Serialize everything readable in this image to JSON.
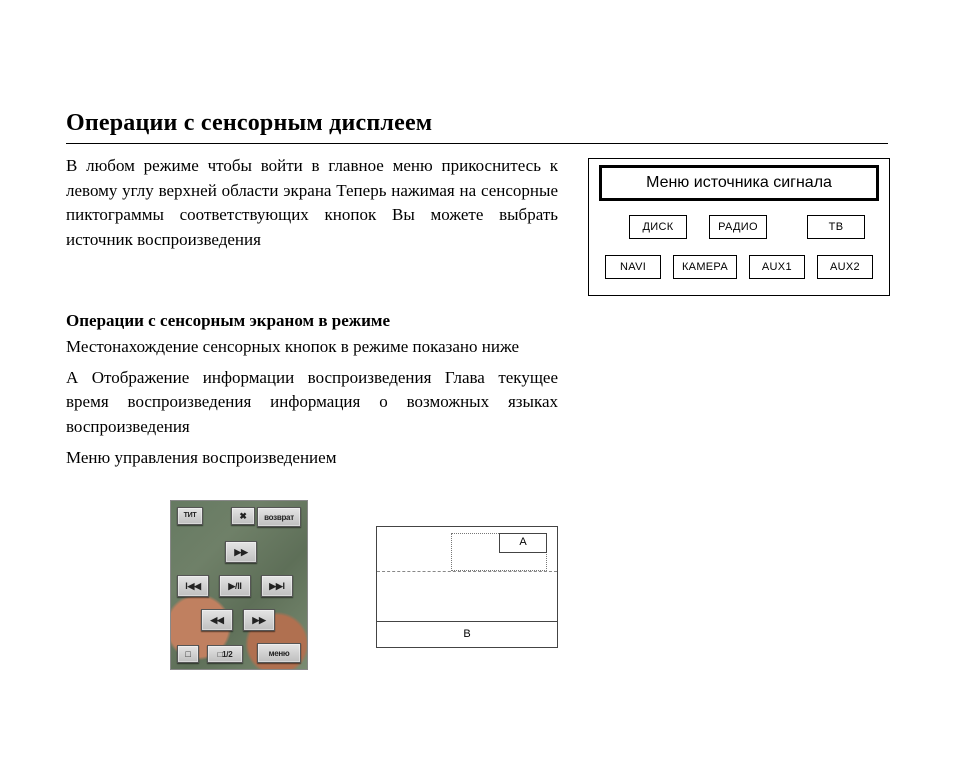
{
  "title": "Операции с сенсорным дисплеем",
  "intro": "В любом режиме чтобы войти в главное меню прикоснитесь к левому углу верхней области экрана Теперь нажимая на сенсорные пиктограммы соответствующих кнопок Вы можете выбрать источник воспроизведения",
  "section2": {
    "heading": "Операции с сенсорным экраном в режиме",
    "line1": "Местонахождение сенсорных кнопок в режиме показано ниже",
    "line2": "А Отображение информации воспроизведения Глава текущее время воспроизведения информация о возможных языках воспроизведения",
    "line3": "Меню управления воспроизведением"
  },
  "source_menu": {
    "title": "Меню источника сигнала",
    "row1": [
      "ДИСК",
      "РАДИО",
      "ТВ"
    ],
    "row2": [
      "NAVI",
      "КАМЕРА",
      "AUX1",
      "AUX2"
    ]
  },
  "panel": {
    "r1a": "ТИТ",
    "r1b": "✖",
    "r1c": "возврат",
    "r2a": "▶▶",
    "r3a": "I◀◀",
    "r3b": "▶/II",
    "r3c": "▶▶I",
    "r4a": "◀◀",
    "r4b": "▶▶",
    "r5a": "□",
    "r5b": "□1/2",
    "r5c": "меню"
  },
  "regions": {
    "A": "A",
    "B": "B"
  }
}
